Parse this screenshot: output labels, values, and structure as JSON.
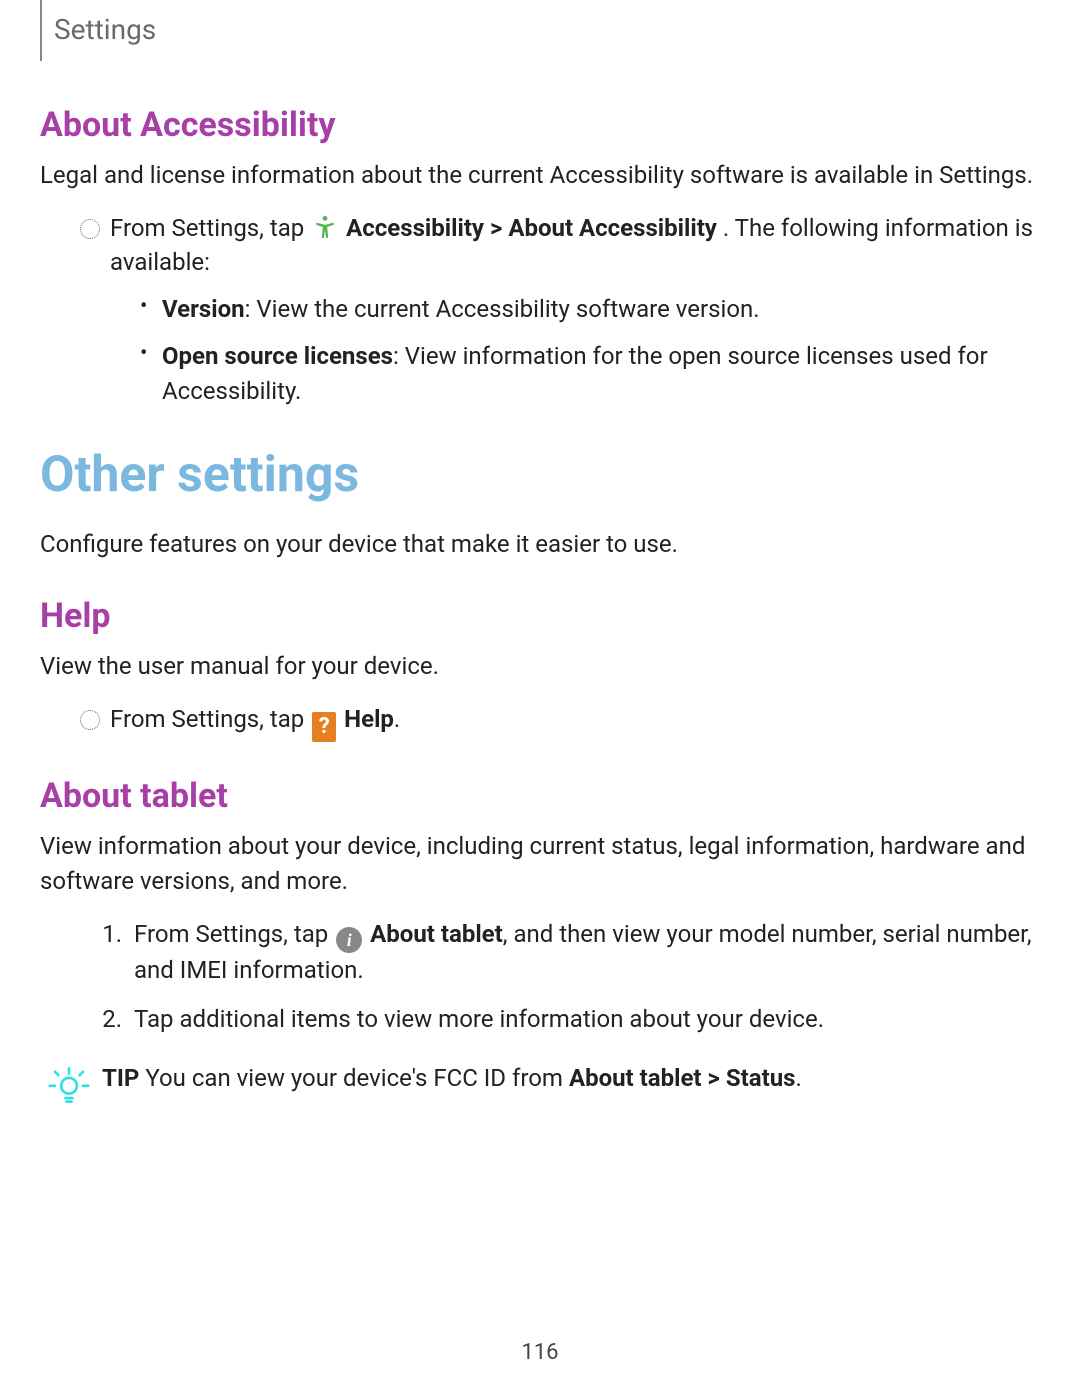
{
  "header": {
    "title": "Settings"
  },
  "about_accessibility": {
    "heading": "About Accessibility",
    "intro": "Legal and license information about the current Accessibility software is available in Settings.",
    "step_prefix": "From Settings, tap ",
    "step_bold": "Accessibility > About Accessibility",
    "step_suffix": ". The following information is available:",
    "items": [
      {
        "label": "Version",
        "desc": ": View the current Accessibility software version."
      },
      {
        "label": "Open source licenses",
        "desc": ": View information for the open source licenses used for Accessibility."
      }
    ]
  },
  "other_settings": {
    "heading": "Other settings",
    "intro": "Configure features on your device that make it easier to use."
  },
  "help": {
    "heading": "Help",
    "intro": "View the user manual for your device.",
    "step_prefix": "From Settings, tap ",
    "step_bold": "Help",
    "step_suffix": "."
  },
  "about_tablet": {
    "heading": "About tablet",
    "intro": "View information about your device, including current status, legal information, hardware and software versions, and more.",
    "steps": [
      {
        "prefix": "From Settings, tap ",
        "bold": "About tablet",
        "suffix": ", and then view your model number, serial number, and IMEI information."
      },
      {
        "prefix": "Tap additional items to view more information about your device.",
        "bold": "",
        "suffix": ""
      }
    ],
    "tip_label": "TIP",
    "tip_prefix": "  You can view your device's FCC ID from ",
    "tip_bold": "About tablet > Status",
    "tip_suffix": "."
  },
  "page_number": "116"
}
